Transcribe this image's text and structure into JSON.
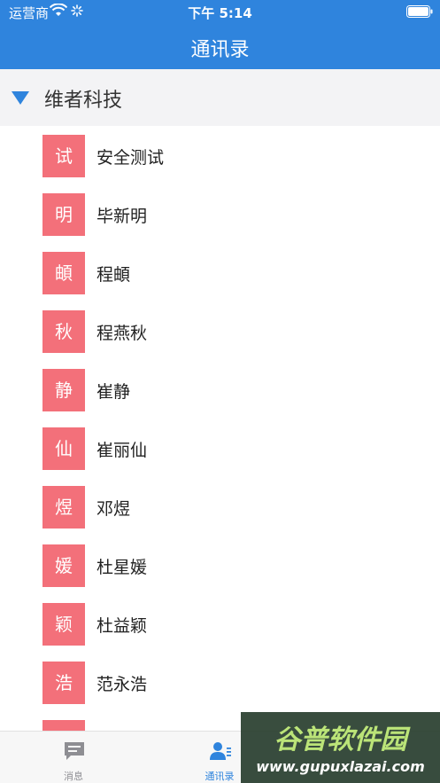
{
  "status_bar": {
    "carrier": "运营商",
    "time": "下午 5:14"
  },
  "nav": {
    "title": "通讯录"
  },
  "group": {
    "name": "维者科技",
    "expanded": true
  },
  "contacts": [
    {
      "avatar": "试",
      "name": "安全测试"
    },
    {
      "avatar": "明",
      "name": "毕新明"
    },
    {
      "avatar": "頔",
      "name": "程頔"
    },
    {
      "avatar": "秋",
      "name": "程燕秋"
    },
    {
      "avatar": "静",
      "name": "崔静"
    },
    {
      "avatar": "仙",
      "name": "崔丽仙"
    },
    {
      "avatar": "煜",
      "name": "邓煜"
    },
    {
      "avatar": "媛",
      "name": "杜星媛"
    },
    {
      "avatar": "颖",
      "name": "杜益颖"
    },
    {
      "avatar": "浩",
      "name": "范永浩"
    },
    {
      "avatar": "",
      "name": ""
    }
  ],
  "tabs": [
    {
      "label": "消息",
      "icon": "message-icon",
      "active": false
    },
    {
      "label": "通讯录",
      "icon": "contacts-icon",
      "active": true
    }
  ],
  "watermark": {
    "title": "谷普软件园",
    "url": "www.gupuxlazai.com"
  },
  "colors": {
    "primary": "#2f84dd",
    "avatar_bg": "#f3707a",
    "tab_inactive": "#8e8e93"
  }
}
